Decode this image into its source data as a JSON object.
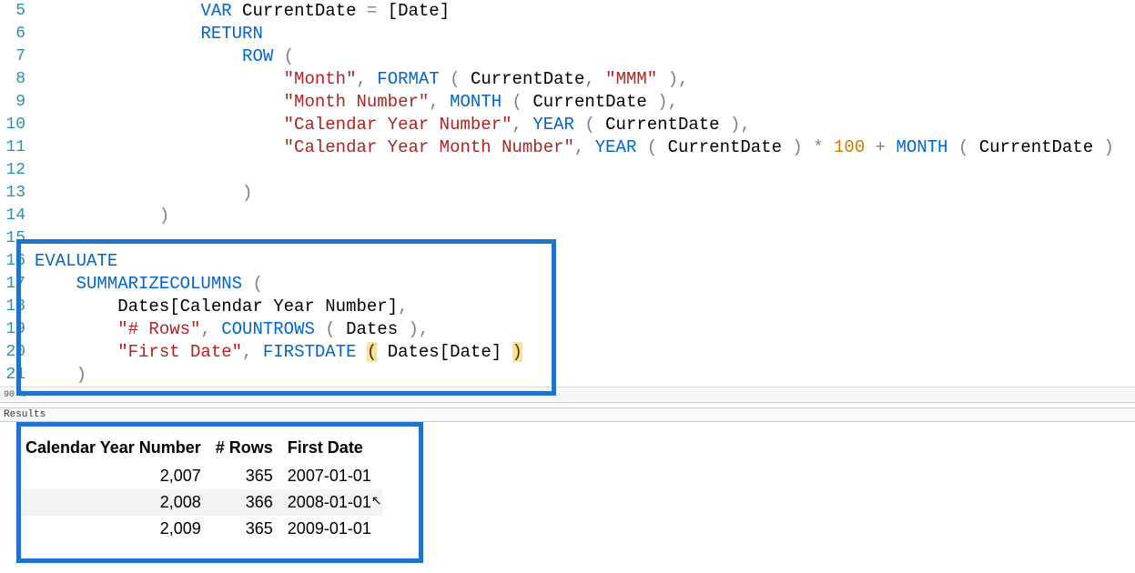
{
  "code": {
    "lines": [
      {
        "n": 5,
        "indent": "                ",
        "tokens": [
          {
            "t": "VAR",
            "c": "kw"
          },
          {
            "t": " CurrentDate ",
            "c": "ident"
          },
          {
            "t": "=",
            "c": "punc"
          },
          {
            "t": " ",
            "c": "ident"
          },
          {
            "t": "[Date]",
            "c": "ident"
          }
        ]
      },
      {
        "n": 6,
        "indent": "                ",
        "tokens": [
          {
            "t": "RETURN",
            "c": "kw"
          }
        ]
      },
      {
        "n": 7,
        "indent": "                    ",
        "tokens": [
          {
            "t": "ROW",
            "c": "fn"
          },
          {
            "t": " ",
            "c": "ident"
          },
          {
            "t": "(",
            "c": "punc"
          }
        ]
      },
      {
        "n": 8,
        "indent": "                        ",
        "tokens": [
          {
            "t": "\"Month\"",
            "c": "str"
          },
          {
            "t": ", ",
            "c": "punc"
          },
          {
            "t": "FORMAT",
            "c": "fn"
          },
          {
            "t": " ",
            "c": "ident"
          },
          {
            "t": "( ",
            "c": "punc"
          },
          {
            "t": "CurrentDate",
            "c": "ident"
          },
          {
            "t": ", ",
            "c": "punc"
          },
          {
            "t": "\"MMM\"",
            "c": "str"
          },
          {
            "t": " )",
            "c": "punc"
          },
          {
            "t": ",",
            "c": "punc"
          }
        ]
      },
      {
        "n": 9,
        "indent": "                        ",
        "tokens": [
          {
            "t": "\"Month Number\"",
            "c": "str"
          },
          {
            "t": ", ",
            "c": "punc"
          },
          {
            "t": "MONTH",
            "c": "fn"
          },
          {
            "t": " ",
            "c": "ident"
          },
          {
            "t": "( ",
            "c": "punc"
          },
          {
            "t": "CurrentDate",
            "c": "ident"
          },
          {
            "t": " )",
            "c": "punc"
          },
          {
            "t": ",",
            "c": "punc"
          }
        ]
      },
      {
        "n": 10,
        "indent": "                        ",
        "tokens": [
          {
            "t": "\"Calendar Year Number\"",
            "c": "str"
          },
          {
            "t": ", ",
            "c": "punc"
          },
          {
            "t": "YEAR",
            "c": "fn"
          },
          {
            "t": " ",
            "c": "ident"
          },
          {
            "t": "( ",
            "c": "punc"
          },
          {
            "t": "CurrentDate",
            "c": "ident"
          },
          {
            "t": " )",
            "c": "punc"
          },
          {
            "t": ",",
            "c": "punc"
          }
        ]
      },
      {
        "n": 11,
        "indent": "                        ",
        "tokens": [
          {
            "t": "\"Calendar Year Month Number\"",
            "c": "str"
          },
          {
            "t": ", ",
            "c": "punc"
          },
          {
            "t": "YEAR",
            "c": "fn"
          },
          {
            "t": " ",
            "c": "ident"
          },
          {
            "t": "( ",
            "c": "punc"
          },
          {
            "t": "CurrentDate",
            "c": "ident"
          },
          {
            "t": " )",
            "c": "punc"
          },
          {
            "t": " ",
            "c": "ident"
          },
          {
            "t": "*",
            "c": "punc"
          },
          {
            "t": " ",
            "c": "ident"
          },
          {
            "t": "100",
            "c": "num"
          },
          {
            "t": " ",
            "c": "ident"
          },
          {
            "t": "+",
            "c": "punc"
          },
          {
            "t": " ",
            "c": "ident"
          },
          {
            "t": "MONTH",
            "c": "fn"
          },
          {
            "t": " ",
            "c": "ident"
          },
          {
            "t": "( ",
            "c": "punc"
          },
          {
            "t": "CurrentDate",
            "c": "ident"
          },
          {
            "t": " )",
            "c": "punc"
          }
        ]
      },
      {
        "n": 12,
        "indent": "",
        "tokens": []
      },
      {
        "n": 13,
        "indent": "                    ",
        "tokens": [
          {
            "t": ")",
            "c": "punc"
          }
        ]
      },
      {
        "n": 14,
        "indent": "            ",
        "tokens": [
          {
            "t": ")",
            "c": "punc"
          }
        ]
      },
      {
        "n": 15,
        "indent": "",
        "tokens": []
      },
      {
        "n": 16,
        "indent": "",
        "tokens": [
          {
            "t": "EVALUATE",
            "c": "kw"
          }
        ]
      },
      {
        "n": 17,
        "indent": "    ",
        "tokens": [
          {
            "t": "SUMMARIZECOLUMNS",
            "c": "fn"
          },
          {
            "t": " ",
            "c": "ident"
          },
          {
            "t": "(",
            "c": "punc"
          }
        ]
      },
      {
        "n": 18,
        "indent": "        ",
        "tokens": [
          {
            "t": "Dates[Calendar Year Number]",
            "c": "ident"
          },
          {
            "t": ",",
            "c": "punc"
          }
        ]
      },
      {
        "n": 19,
        "indent": "        ",
        "tokens": [
          {
            "t": "\"# Rows\"",
            "c": "str"
          },
          {
            "t": ", ",
            "c": "punc"
          },
          {
            "t": "COUNTROWS",
            "c": "fn"
          },
          {
            "t": " ",
            "c": "ident"
          },
          {
            "t": "( ",
            "c": "punc"
          },
          {
            "t": "Dates",
            "c": "ident"
          },
          {
            "t": " )",
            "c": "punc"
          },
          {
            "t": ",",
            "c": "punc"
          }
        ]
      },
      {
        "n": 20,
        "indent": "        ",
        "tokens": [
          {
            "t": "\"First Date\"",
            "c": "str"
          },
          {
            "t": ", ",
            "c": "punc"
          },
          {
            "t": "FIRSTDATE",
            "c": "fn"
          },
          {
            "t": " ",
            "c": "ident"
          },
          {
            "t": "(",
            "c": "paren-h"
          },
          {
            "t": " ",
            "c": "ident"
          },
          {
            "t": "Dates[Date]",
            "c": "ident"
          },
          {
            "t": " ",
            "c": "ident"
          },
          {
            "t": ")",
            "c": "paren-h"
          }
        ]
      },
      {
        "n": 21,
        "indent": "    ",
        "tokens": [
          {
            "t": ")",
            "c": "punc"
          }
        ]
      }
    ]
  },
  "zoom": "90 % ▾  ◂",
  "results_label": "Results",
  "results": {
    "headers": [
      "Calendar Year Number",
      "# Rows",
      "First Date"
    ],
    "rows": [
      {
        "year": "2,007",
        "rows": "365",
        "date": "2007-01-01"
      },
      {
        "year": "2,008",
        "rows": "366",
        "date": "2008-01-01"
      },
      {
        "year": "2,009",
        "rows": "365",
        "date": "2009-01-01"
      }
    ]
  }
}
